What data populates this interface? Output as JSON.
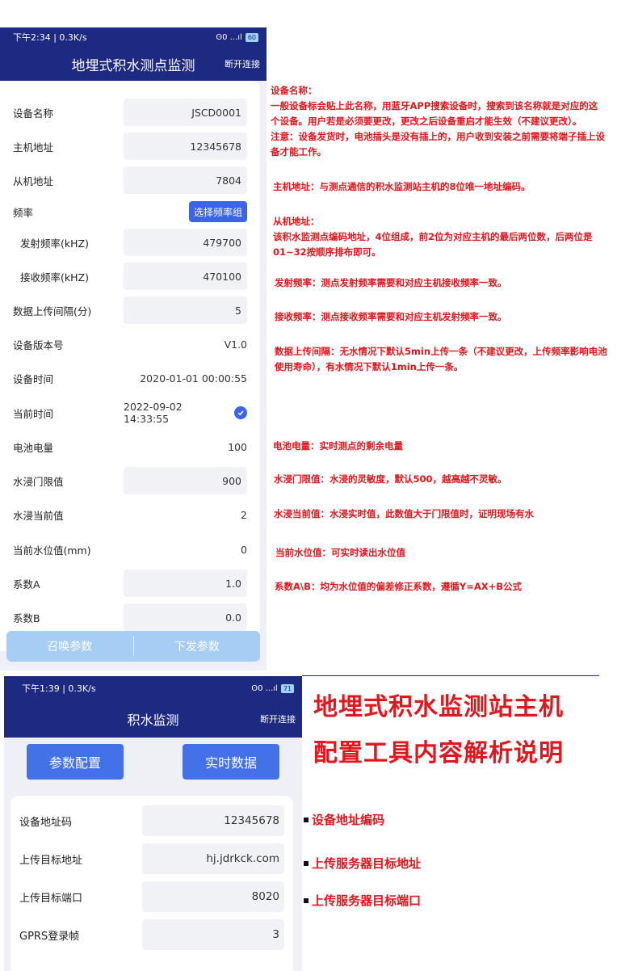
{
  "phone1": {
    "status": {
      "time": "下午2:34 | 0.3K/s",
      "icons": "ʘ0 ...ıl",
      "battery": "60"
    },
    "title": "地埋式积水测点监测",
    "disconnect": "断开连接",
    "rows": [
      {
        "label": "设备名称",
        "value": "JSCD0001"
      },
      {
        "label": "主机地址",
        "value": "12345678"
      },
      {
        "label": "从机地址",
        "value": "7804"
      },
      {
        "label": "频率",
        "button": "选择频率组"
      },
      {
        "label": "发射频率(kHZ)",
        "value": "479700"
      },
      {
        "label": "接收频率(kHZ)",
        "value": "470100"
      },
      {
        "label": "数据上传间隔(分)",
        "value": "5"
      },
      {
        "label": "设备版本号",
        "value": "V1.0"
      },
      {
        "label": "设备时间",
        "value": "2020-01-01 00:00:55"
      },
      {
        "label": "当前时间",
        "value": "2022-09-02 14:33:55"
      },
      {
        "label": "电池电量",
        "value": "100"
      },
      {
        "label": "水浸门限值",
        "value": "900"
      },
      {
        "label": "水浸当前值",
        "value": "2"
      },
      {
        "label": "当前水位值(mm)",
        "value": "0"
      },
      {
        "label": "系数A",
        "value": "1.0"
      },
      {
        "label": "系数B",
        "value": "0.0"
      }
    ],
    "buttons": {
      "recall": "召唤参数",
      "send": "下发参数"
    }
  },
  "notes": {
    "device_name": [
      "设备名称：",
      "一般设备标会贴上此名称，用蓝牙APP搜索设备时，搜索到该名称就是对应的这",
      "个设备。用户若是必须要更改，更改之后设备重启才能生效（不建议更改）。",
      "注意：设备发货时，电池插头是没有插上的，用户收到安装之前需要将端子插上设",
      "备才能工作。"
    ],
    "host_addr": "主机地址：与测点通信的积水监测站主机的8位唯一地址编码。",
    "slave_addr": [
      "从机地址：",
      "该积水监测点编码地址，4位组成，前2位为对应主机的最后两位数，后两位是",
      "01~32按顺序排布即可。"
    ],
    "tx_freq": "发射频率：测点发射频率需要和对应主机接收频率一致。",
    "rx_freq": "接收频率：测点接收频率需要和对应主机发射频率一致。",
    "upload": [
      "数据上传间隔：无水情况下默认5min上传一条（不建议更改，上传频率影响电池",
      "使用寿命），有水情况下默认1min上传一条。"
    ],
    "battery": "电池电量：实时测点的剩余电量",
    "threshold": "水浸门限值：水浸的灵敏度，默认500，越高越不灵敏。",
    "current": "水浸当前值：水浸实时值，此数值大于门限值时，证明现场有水",
    "level": "当前水位值：可实时读出水位值",
    "coef": "系数A\\B：均为水位值的偏差修正系数，遵循Y=AX+B公式"
  },
  "phone2": {
    "status": {
      "time": "下午1:39 | 0.3K/s",
      "icons": "ʘ0 ...ıl",
      "battery": "71"
    },
    "title": "积水监测",
    "disconnect": "断开连接",
    "tabs": {
      "config": "参数配置",
      "realtime": "实时数据"
    },
    "rows": [
      {
        "label": "设备地址码",
        "value": "12345678"
      },
      {
        "label": "上传目标地址",
        "value": "hj.jdrkck.com"
      },
      {
        "label": "上传目标端口",
        "value": "8020"
      },
      {
        "label": "GPRS登录帧",
        "value": "3"
      }
    ]
  },
  "headline": {
    "line1": "地埋式积水监测站主机",
    "line2": "配置工具内容解析说明"
  },
  "bullets": [
    "设备地址编码",
    "上传服务器目标地址",
    "上传服务器目标端口"
  ],
  "colors": {
    "primary": "#1c2a82",
    "accent": "#3b64e6",
    "annotation": "#e3161d"
  }
}
